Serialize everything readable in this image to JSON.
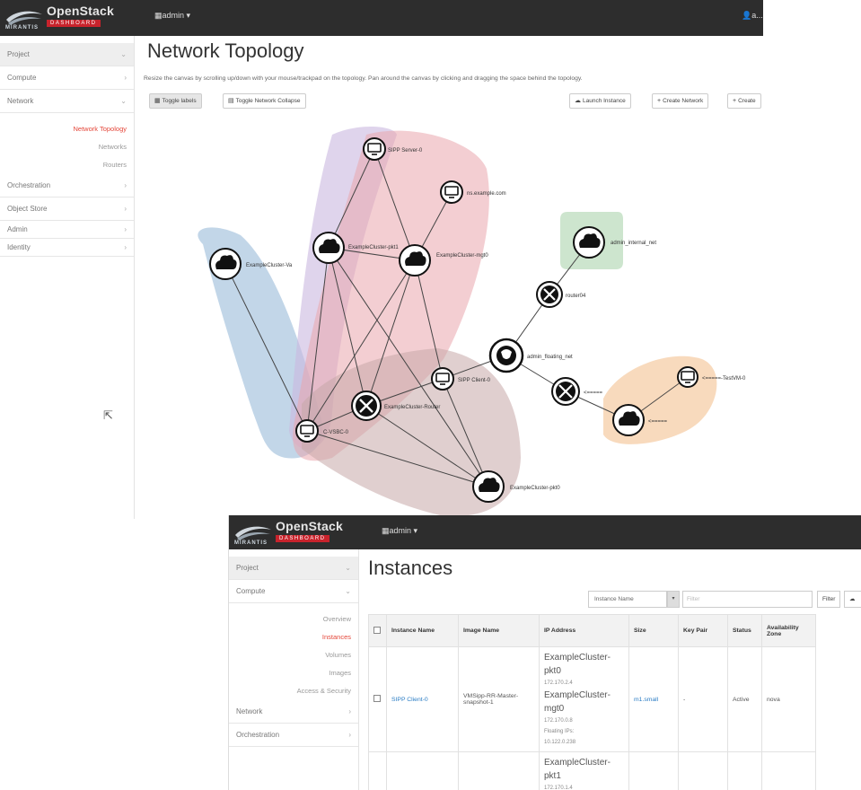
{
  "screen1": {
    "header": {
      "brand": "OpenStack",
      "brand_sub": "DASHBOARD",
      "brand_corp": "MIRANTIS",
      "project_menu": "admin",
      "user_menu": "a..."
    },
    "sidebar": {
      "project": "Project",
      "compute": "Compute",
      "network": "Network",
      "network_topology": "Network Topology",
      "networks": "Networks",
      "routers": "Routers",
      "orchestration": "Orchestration",
      "object_store": "Object Store",
      "admin": "Admin",
      "identity": "Identity"
    },
    "title": "Network Topology",
    "help": "Resize the canvas by scrolling up/down with your mouse/trackpad on the topology. Pan around the canvas by clicking and dragging the space behind the topology.",
    "toolbar": {
      "toggle_labels": "Toggle labels",
      "toggle_collapse": "Toggle Network Collapse",
      "launch_instance": "Launch Instance",
      "create_network": "Create Network",
      "create_router": "Create"
    },
    "nodes": {
      "sipp_server": "SIPP Server-0",
      "ns_example": "ns.example.com",
      "cluster_va": "ExampleCluster-Va",
      "cluster_pkt1": "ExampleCluster-pkt1",
      "cluster_mgt0": "ExampleCluster-mgt0",
      "admin_internal": "admin_internal_net",
      "router04": "router04",
      "admin_floating": "admin_floating_net",
      "sipp_client": "SIPP Client-0",
      "cluster_router": "ExampleCluster-Router",
      "router_x": "<=====",
      "testvm": "<=====-TestVM-0",
      "net_x": "<=====",
      "vsbc": "C-VSBC-0",
      "cluster_pkt0": "ExampleCluster-pkt0"
    }
  },
  "screen2": {
    "header": {
      "brand": "OpenStack",
      "brand_sub": "DASHBOARD",
      "brand_corp": "MIRANTIS",
      "project_menu": "admin"
    },
    "sidebar": {
      "project": "Project",
      "compute": "Compute",
      "overview": "Overview",
      "instances": "Instances",
      "volumes": "Volumes",
      "images": "Images",
      "access": "Access & Security",
      "network": "Network",
      "orchestration": "Orchestration"
    },
    "title": "Instances",
    "filter": {
      "field": "Instance Name",
      "placeholder": "Filter",
      "button": "Filter"
    },
    "table": {
      "headers": [
        "Instance Name",
        "Image Name",
        "IP Address",
        "Size",
        "Key Pair",
        "Status",
        "Availability Zone"
      ],
      "row1": {
        "name": "SIPP Client-0",
        "image": "VMSipp-RR-Master-snapshot-1",
        "ip1_name": "ExampleCluster-pkt0",
        "ip1_addr": "172.170.2.4",
        "ip2_name": "ExampleCluster-mgt0",
        "ip2_addr": "172.170.0.8",
        "floating_label": "Floating IPs:",
        "floating_addr": "10.122.0.238",
        "size": "m1.small",
        "key_pair": "-",
        "status": "Active",
        "zone": "nova"
      },
      "row2": {
        "ip1_name": "ExampleCluster-pkt1",
        "ip1_addr": "172.170.1.4"
      }
    }
  }
}
